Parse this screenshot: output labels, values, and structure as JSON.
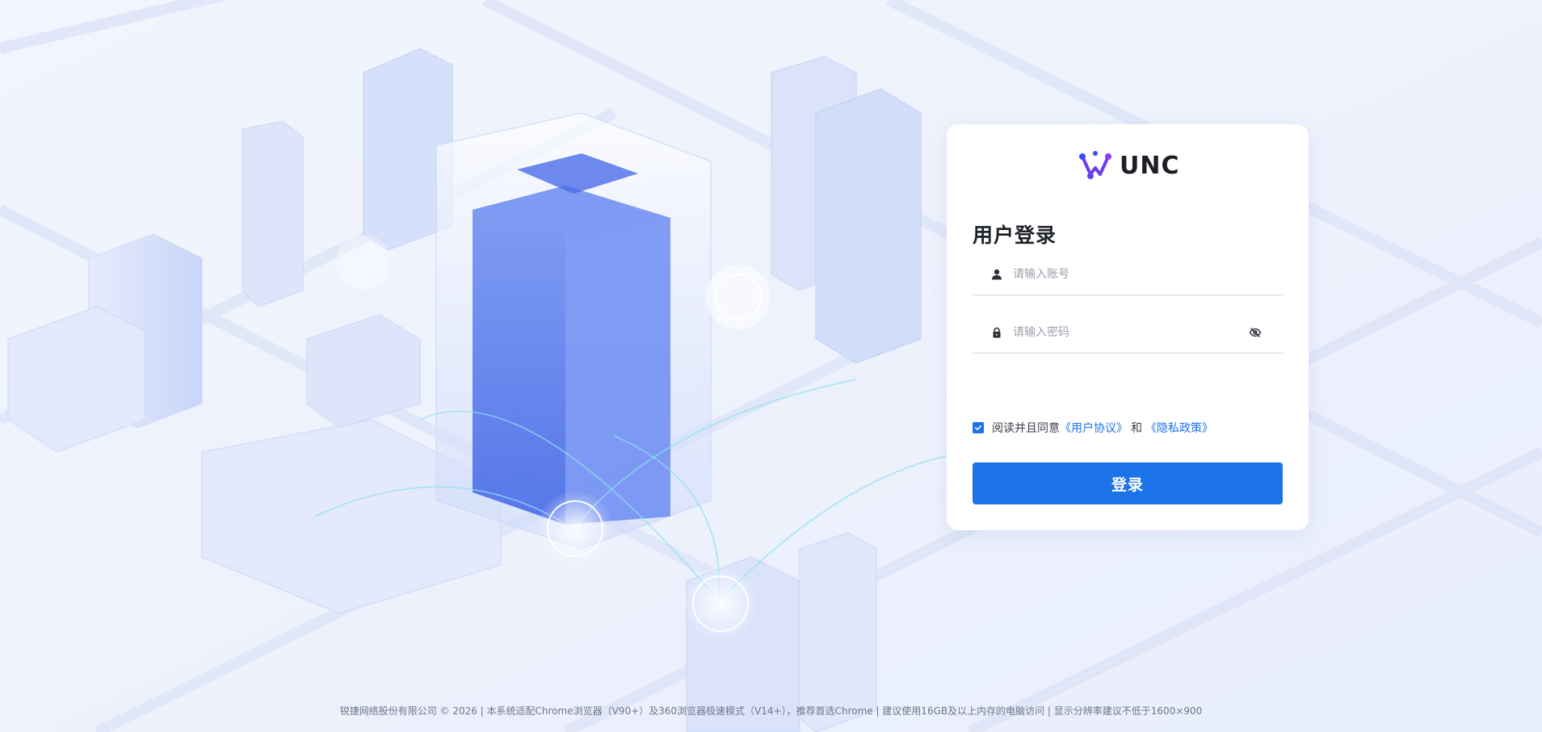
{
  "brand": {
    "logo_text": "UNC"
  },
  "login": {
    "title": "用户登录",
    "account_placeholder": "请输入账号",
    "password_placeholder": "请输入密码",
    "agree_prefix": "阅读并且同意",
    "user_agreement": "《用户协议》",
    "and": "和",
    "privacy_policy": "《隐私政策》",
    "agree_checked": true,
    "submit_label": "登录"
  },
  "footer": {
    "text": "锐捷网络股份有限公司 © 2026 | 本系统适配Chrome浏览器（V90+）及360浏览器极速模式（V14+），推荐首选Chrome | 建议使用16GB及以上内存的电脑访问 | 显示分辨率建议不低于1600×900"
  },
  "colors": {
    "accent": "#1d73e8",
    "background": "#eef2fc"
  }
}
